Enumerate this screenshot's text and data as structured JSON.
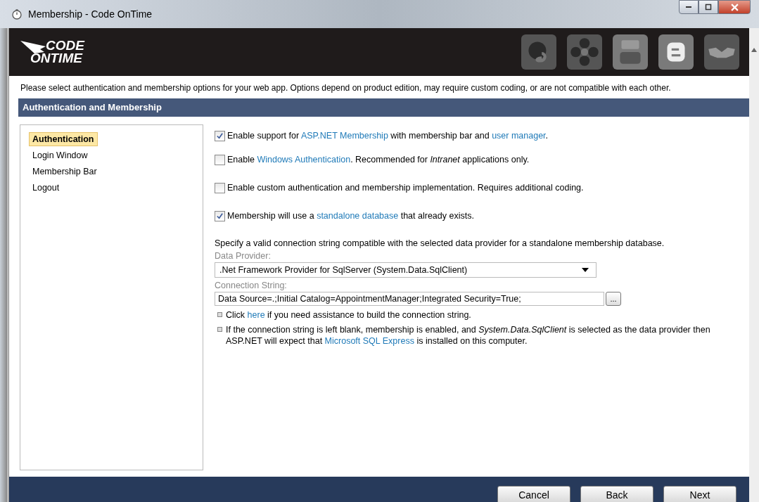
{
  "window": {
    "title": "Membership - Code OnTime"
  },
  "logo": {
    "line_1": "CODE",
    "line_2": "ONTIME"
  },
  "intro": "Please select authentication and membership options for your web app. Options depend on product edition, may require custom coding, or are not compatible with each other.",
  "section_title": "Authentication and Membership",
  "sidebar": {
    "items": [
      {
        "label": "Authentication",
        "selected": true
      },
      {
        "label": "Login Window",
        "selected": false
      },
      {
        "label": "Membership Bar",
        "selected": false
      },
      {
        "label": "Logout",
        "selected": false
      }
    ]
  },
  "options": [
    {
      "checked": true,
      "parts": [
        {
          "kind": "plain",
          "text": "Enable support for "
        },
        {
          "kind": "link",
          "text": "ASP.NET Membership"
        },
        {
          "kind": "plain",
          "text": " with membership bar and "
        },
        {
          "kind": "link",
          "text": "user manager"
        },
        {
          "kind": "plain",
          "text": "."
        }
      ]
    },
    {
      "checked": false,
      "parts": [
        {
          "kind": "plain",
          "text": "Enable "
        },
        {
          "kind": "link",
          "text": "Windows Authentication"
        },
        {
          "kind": "plain",
          "text": ". Recommended for "
        },
        {
          "kind": "italic",
          "text": "Intranet"
        },
        {
          "kind": "plain",
          "text": " applications only."
        }
      ]
    },
    {
      "checked": false,
      "parts": [
        {
          "kind": "plain",
          "text": "Enable custom authentication and membership implementation. Requires additional coding."
        }
      ]
    },
    {
      "checked": true,
      "parts": [
        {
          "kind": "plain",
          "text": "Membership will use a "
        },
        {
          "kind": "link",
          "text": "standalone database"
        },
        {
          "kind": "plain",
          "text": " that already exists."
        }
      ]
    }
  ],
  "connection_hint": "Specify a valid connection string compatible with the selected data provider for a standalone membership database.",
  "data_provider": {
    "label": "Data Provider:",
    "value": ".Net Framework Provider for SqlServer (System.Data.SqlClient)"
  },
  "connection_string": {
    "label": "Connection String:",
    "value": "Data Source=.;Initial Catalog=AppointmentManager;Integrated Security=True;",
    "button": "..."
  },
  "notes": [
    {
      "parts": [
        {
          "kind": "plain",
          "text": "Click "
        },
        {
          "kind": "link",
          "text": "here"
        },
        {
          "kind": "plain",
          "text": " if you need assistance to build the connection string."
        }
      ]
    },
    {
      "parts": [
        {
          "kind": "plain",
          "text": "If the connection string is left blank, membership is enabled, and "
        },
        {
          "kind": "italic",
          "text": "System.Data.SqlClient"
        },
        {
          "kind": "plain",
          "text": " is selected as the data provider then ASP.NET will expect that "
        },
        {
          "kind": "link",
          "text": "Microsoft SQL Express"
        },
        {
          "kind": "plain",
          "text": " is installed on this computer."
        }
      ]
    }
  ],
  "buttons": [
    "Cancel",
    "Back",
    "Next"
  ]
}
